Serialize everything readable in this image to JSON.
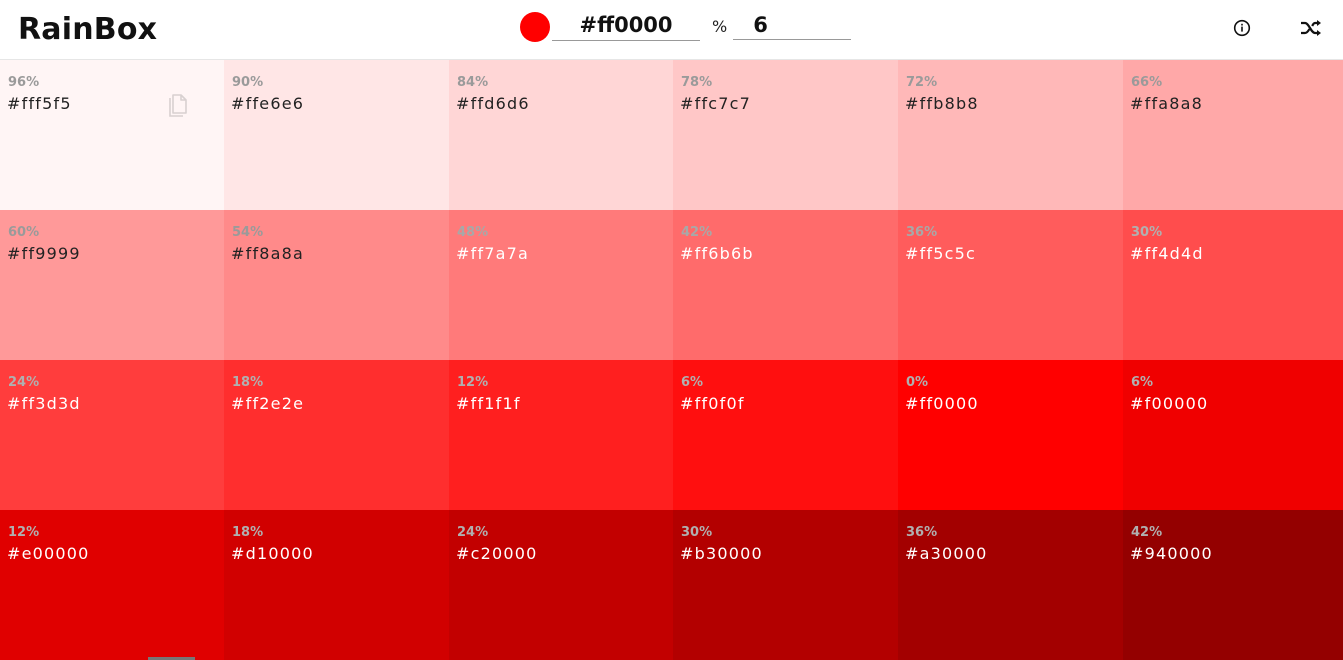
{
  "app": {
    "title": "RainBox"
  },
  "controls": {
    "color_value": "#ff0000",
    "swatch_color": "#ff0000",
    "percent_symbol": "%",
    "step_value": "6"
  },
  "icons": {
    "info": "info-icon",
    "shuffle": "shuffle-icon",
    "copy": "copy-icon"
  },
  "grid": [
    {
      "pct": "96%",
      "hex": "#fff5f5",
      "bg": "#fff5f5",
      "fg": "#222222",
      "pctColor": "#9a9a9a"
    },
    {
      "pct": "90%",
      "hex": "#ffe6e6",
      "bg": "#ffe6e6",
      "fg": "#222222",
      "pctColor": "#9a9a9a"
    },
    {
      "pct": "84%",
      "hex": "#ffd6d6",
      "bg": "#ffd6d6",
      "fg": "#222222",
      "pctColor": "#9a9a9a"
    },
    {
      "pct": "78%",
      "hex": "#ffc7c7",
      "bg": "#ffc7c7",
      "fg": "#222222",
      "pctColor": "#9a9a9a"
    },
    {
      "pct": "72%",
      "hex": "#ffb8b8",
      "bg": "#ffb8b8",
      "fg": "#222222",
      "pctColor": "#9a9a9a"
    },
    {
      "pct": "66%",
      "hex": "#ffa8a8",
      "bg": "#ffa8a8",
      "fg": "#222222",
      "pctColor": "#9a9a9a"
    },
    {
      "pct": "60%",
      "hex": "#ff9999",
      "bg": "#ff9999",
      "fg": "#222222",
      "pctColor": "#9a9a9a"
    },
    {
      "pct": "54%",
      "hex": "#ff8a8a",
      "bg": "#ff8a8a",
      "fg": "#222222",
      "pctColor": "#9a9a9a"
    },
    {
      "pct": "48%",
      "hex": "#ff7a7a",
      "bg": "#ff7a7a",
      "fg": "#ffffff",
      "pctColor": "#a8a8a8"
    },
    {
      "pct": "42%",
      "hex": "#ff6b6b",
      "bg": "#ff6b6b",
      "fg": "#ffffff",
      "pctColor": "#a8a8a8"
    },
    {
      "pct": "36%",
      "hex": "#ff5c5c",
      "bg": "#ff5c5c",
      "fg": "#ffffff",
      "pctColor": "#a8a8a8"
    },
    {
      "pct": "30%",
      "hex": "#ff4d4d",
      "bg": "#ff4d4d",
      "fg": "#ffffff",
      "pctColor": "#b0b0b0"
    },
    {
      "pct": "24%",
      "hex": "#ff3d3d",
      "bg": "#ff3d3d",
      "fg": "#ffffff",
      "pctColor": "#b0b0b0"
    },
    {
      "pct": "18%",
      "hex": "#ff2e2e",
      "bg": "#ff2e2e",
      "fg": "#ffffff",
      "pctColor": "#b0b0b0"
    },
    {
      "pct": "12%",
      "hex": "#ff1f1f",
      "bg": "#ff1f1f",
      "fg": "#ffffff",
      "pctColor": "#b0b0b0"
    },
    {
      "pct": "6%",
      "hex": "#ff0f0f",
      "bg": "#ff0f0f",
      "fg": "#ffffff",
      "pctColor": "#b0b0b0"
    },
    {
      "pct": "0%",
      "hex": "#ff0000",
      "bg": "#ff0000",
      "fg": "#ffffff",
      "pctColor": "#b0b0b0"
    },
    {
      "pct": "6%",
      "hex": "#f00000",
      "bg": "#f00000",
      "fg": "#ffffff",
      "pctColor": "#b0b0b0"
    },
    {
      "pct": "12%",
      "hex": "#e00000",
      "bg": "#e00000",
      "fg": "#ffffff",
      "pctColor": "#b0b0b0"
    },
    {
      "pct": "18%",
      "hex": "#d10000",
      "bg": "#d10000",
      "fg": "#ffffff",
      "pctColor": "#b0b0b0"
    },
    {
      "pct": "24%",
      "hex": "#c20000",
      "bg": "#c20000",
      "fg": "#ffffff",
      "pctColor": "#b0b0b0"
    },
    {
      "pct": "30%",
      "hex": "#b30000",
      "bg": "#b30000",
      "fg": "#ffffff",
      "pctColor": "#b0b0b0"
    },
    {
      "pct": "36%",
      "hex": "#a30000",
      "bg": "#a30000",
      "fg": "#ffffff",
      "pctColor": "#b0b0b0"
    },
    {
      "pct": "42%",
      "hex": "#940000",
      "bg": "#940000",
      "fg": "#ffffff",
      "pctColor": "#b0b0b0"
    }
  ]
}
